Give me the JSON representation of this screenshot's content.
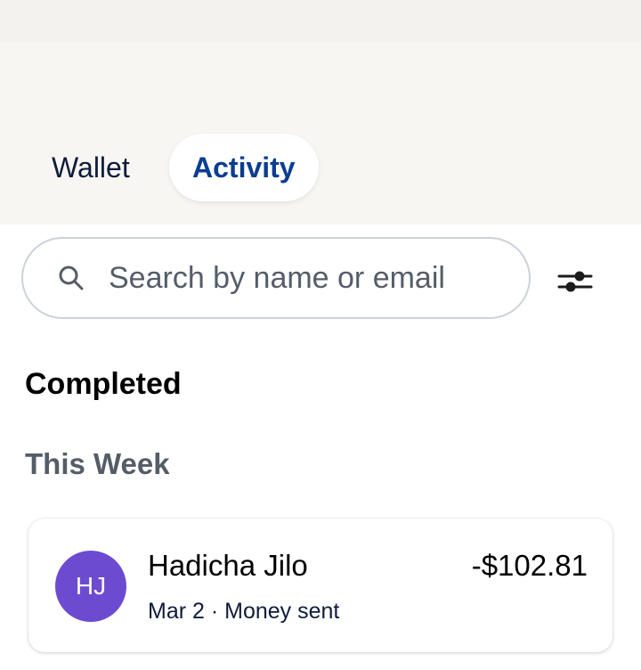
{
  "tabs": [
    {
      "label": "Wallet",
      "active": false
    },
    {
      "label": "Activity",
      "active": true
    }
  ],
  "search": {
    "placeholder": "Search by name or email",
    "value": "",
    "icon": "search-icon"
  },
  "filter": {
    "icon": "filter-sliders-icon"
  },
  "section": {
    "title": "Completed"
  },
  "group": {
    "label": "This Week"
  },
  "transactions": [
    {
      "initials": "HJ",
      "avatar_color": "#6c4bd1",
      "name": "Hadicha Jilo",
      "amount": "-$102.81",
      "date": "Mar 2",
      "separator": "·",
      "type": "Money sent"
    }
  ],
  "colors": {
    "accent": "#0b3d91",
    "header_bg": "#f8f6f3",
    "text_primary": "#000000",
    "text_secondary": "#545d68"
  }
}
